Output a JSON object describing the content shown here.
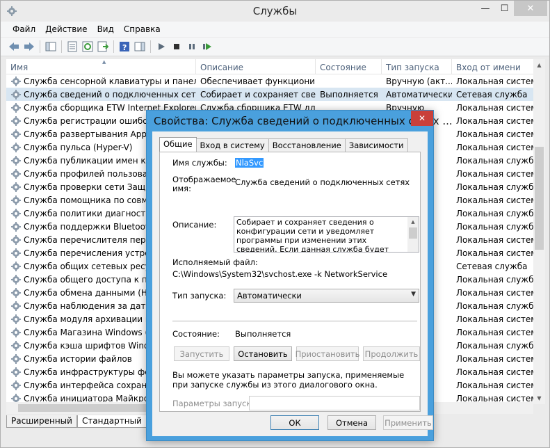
{
  "window": {
    "title": "Службы",
    "controls": {
      "minimize": "—",
      "maximize": "☐",
      "close": "✕"
    }
  },
  "menu": [
    "Файл",
    "Действие",
    "Вид",
    "Справка"
  ],
  "list": {
    "columns": [
      "Имя",
      "Описание",
      "Состояние",
      "Тип запуска",
      "Вход от имени"
    ],
    "rows": [
      {
        "name": "Служба сенсорной клавиатуры и панели р...",
        "desc": "Обеспечивает функционир...",
        "state": "",
        "startup": "Вручную (акт...",
        "logon": "Локальная система",
        "selected": false
      },
      {
        "name": "Служба сведений о подключенных сетях",
        "desc": "Собирает и сохраняет сведе...",
        "state": "Выполняется",
        "startup": "Автоматически",
        "logon": "Сетевая служба",
        "selected": true
      },
      {
        "name": "Служба сборщика ETW Internet Explorer",
        "desc": "Служба сборщика ETW дл...",
        "state": "",
        "startup": "Вручную",
        "logon": "Локальная система",
        "selected": false
      },
      {
        "name": "Служба регистрации ошибок W",
        "desc": "",
        "state": "",
        "startup": "",
        "logon": "Локальная система",
        "selected": false
      },
      {
        "name": "Служба развертывания AppX (A",
        "desc": "",
        "state": "",
        "startup": "",
        "logon": "Локальная система",
        "selected": false
      },
      {
        "name": "Служба пульса (Hyper-V)",
        "desc": "",
        "state": "",
        "startup": "",
        "logon": "Локальная система",
        "selected": false
      },
      {
        "name": "Служба публикации имен компь",
        "desc": "",
        "state": "",
        "startup": "",
        "logon": "Локальная служба",
        "selected": false
      },
      {
        "name": "Служба профилей пользовател",
        "desc": "",
        "state": "",
        "startup": "",
        "logon": "Локальная система",
        "selected": false
      },
      {
        "name": "Служба проверки сети Защитни",
        "desc": "",
        "state": "",
        "startup": "",
        "logon": "Локальная служба",
        "selected": false
      },
      {
        "name": "Служба помощника по совмест",
        "desc": "",
        "state": "",
        "startup": "",
        "logon": "Локальная система",
        "selected": false
      },
      {
        "name": "Служба политики диагностики",
        "desc": "",
        "state": "",
        "startup": "",
        "logon": "Локальная служба",
        "selected": false
      },
      {
        "name": "Служба поддержки Bluetooth",
        "desc": "",
        "state": "",
        "startup": "",
        "logon": "Локальная служба",
        "selected": false
      },
      {
        "name": "Служба перечислителя перенос",
        "desc": "",
        "state": "",
        "startup": "",
        "logon": "Локальная система",
        "selected": false
      },
      {
        "name": "Служба перечисления устройст",
        "desc": "",
        "state": "",
        "startup": "",
        "logon": "Локальная система",
        "selected": false
      },
      {
        "name": "Служба общих сетевых ресурсо",
        "desc": "",
        "state": "",
        "startup": "",
        "logon": "Сетевая служба",
        "selected": false
      },
      {
        "name": "Служба общего доступа к порта",
        "desc": "",
        "state": "",
        "startup": "",
        "logon": "Локальная служба",
        "selected": false
      },
      {
        "name": "Служба обмена данными (Hyper",
        "desc": "",
        "state": "",
        "startup": "",
        "logon": "Локальная система",
        "selected": false
      },
      {
        "name": "Служба наблюдения за датчикам",
        "desc": "",
        "state": "",
        "startup": "",
        "logon": "Локальная служба",
        "selected": false
      },
      {
        "name": "Служба модуля архивации на ур",
        "desc": "",
        "state": "",
        "startup": "",
        "logon": "Локальная система",
        "selected": false
      },
      {
        "name": "Служба Магазина Windows (WSS",
        "desc": "",
        "state": "",
        "startup": "",
        "logon": "Локальная система",
        "selected": false
      },
      {
        "name": "Служба кэша шрифтов Window",
        "desc": "",
        "state": "",
        "startup": "",
        "logon": "Локальная служба",
        "selected": false
      },
      {
        "name": "Служба истории файлов",
        "desc": "",
        "state": "",
        "startup": "",
        "logon": "Локальная система",
        "selected": false
      },
      {
        "name": "Служба инфраструктуры фонов",
        "desc": "",
        "state": "",
        "startup": "",
        "logon": "Локальная система",
        "selected": false
      },
      {
        "name": "Служба интерфейса сохранения",
        "desc": "",
        "state": "",
        "startup": "",
        "logon": "Локальная система",
        "selected": false
      },
      {
        "name": "Служба инициатора Майкрософ",
        "desc": "",
        "state": "",
        "startup": "",
        "logon": "Локальная система",
        "selected": false
      }
    ]
  },
  "bottom_tabs": [
    "Расширенный",
    "Стандартный"
  ],
  "dialog": {
    "title": "Свойства: Служба сведений о подключенных сетях ...",
    "close": "✕",
    "tabs": [
      "Общие",
      "Вход в систему",
      "Восстановление",
      "Зависимости"
    ],
    "service_name_label": "Имя службы:",
    "service_name": "NlaSvc",
    "display_name_label": "Отображаемое имя:",
    "display_name": "Служба сведений о подключенных сетях",
    "description_label": "Описание:",
    "description": "Собирает и сохраняет сведения о конфигурации сети и уведомляет программы при изменении этих сведений. Если данная служба будет остановлена, сведения о конфигурации могут",
    "exe_label": "Исполняемый файл:",
    "exe_path": "C:\\Windows\\System32\\svchost.exe -k NetworkService",
    "startup_type_label": "Тип запуска:",
    "startup_type": "Автоматически",
    "status_label": "Состояние:",
    "status": "Выполняется",
    "buttons": {
      "start": "Запустить",
      "stop": "Остановить",
      "pause": "Приостановить",
      "resume": "Продолжить"
    },
    "hint": "Вы можете указать параметры запуска, применяемые при запуске службы из этого диалогового окна.",
    "params_label": "Параметры запуска:",
    "params_value": "",
    "ok": "ОК",
    "cancel": "Отмена",
    "apply": "Применить"
  }
}
